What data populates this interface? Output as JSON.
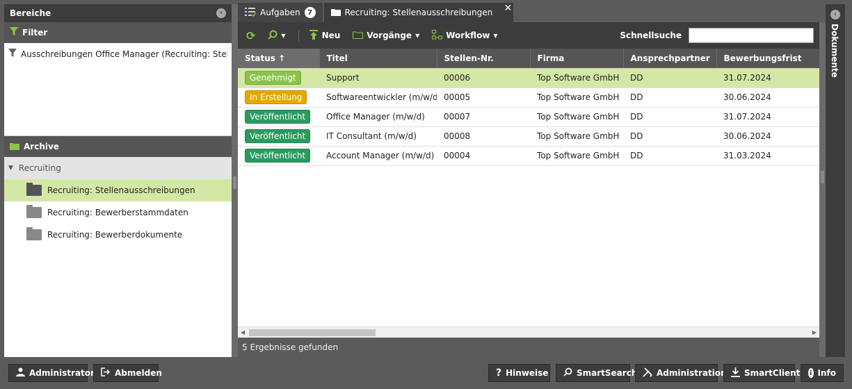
{
  "left": {
    "title": "Bereiche",
    "filter": {
      "label": "Filter",
      "items": [
        "Ausschreibungen Office Manager (Recruiting: Stellenausschreibungen)"
      ]
    },
    "archive": {
      "label": "Archive",
      "group": "Recruiting",
      "items": [
        {
          "label": "Recruiting: Stellenausschreibungen",
          "selected": true
        },
        {
          "label": "Recruiting: Bewerberstammdaten",
          "selected": false
        },
        {
          "label": "Recruiting: Bewerberdokumente",
          "selected": false
        }
      ]
    }
  },
  "tabs": [
    {
      "label": "Aufgaben",
      "badge": "7"
    },
    {
      "label": "Recruiting: Stellenausschreibungen",
      "active": true
    }
  ],
  "toolbar": {
    "new_label": "Neu",
    "procedures_label": "Vorgänge",
    "workflow_label": "Workflow",
    "quicksearch_label": "Schnellsuche",
    "quicksearch_value": ""
  },
  "table": {
    "columns": [
      "Status",
      "Titel",
      "Stellen-Nr.",
      "Firma",
      "Ansprechpartner",
      "Bewerbungsfrist"
    ],
    "sort_indicator": "↑",
    "rows": [
      {
        "status": "Genehmigt",
        "status_color": "#8bc34a",
        "titel": "Support",
        "nr": "00006",
        "firma": "Top Software GmbH",
        "ansprech": "DD",
        "frist": "31.07.2024",
        "selected": true
      },
      {
        "status": "In Erstellung",
        "status_color": "#e6a800",
        "titel": "Softwareentwickler (m/w/d)",
        "nr": "00005",
        "firma": "Top Software GmbH",
        "ansprech": "DD",
        "frist": "30.06.2024",
        "selected": false
      },
      {
        "status": "Veröffentlicht",
        "status_color": "#2a9a5e",
        "titel": "Office Manager (m/w/d)",
        "nr": "00007",
        "firma": "Top Software GmbH",
        "ansprech": "DD",
        "frist": "31.07.2024",
        "selected": false
      },
      {
        "status": "Veröffentlicht",
        "status_color": "#2a9a5e",
        "titel": "IT Consultant (m/w/d)",
        "nr": "00008",
        "firma": "Top Software GmbH",
        "ansprech": "DD",
        "frist": "30.06.2024",
        "selected": false
      },
      {
        "status": "Veröffentlicht",
        "status_color": "#2a9a5e",
        "titel": "Account Manager (m/w/d)",
        "nr": "00004",
        "firma": "Top Software GmbH",
        "ansprech": "DD",
        "frist": "31.03.2024",
        "selected": false
      }
    ]
  },
  "result_text": "5 Ergebnisse gefunden",
  "rightbar_label": "Dokumente",
  "bottom": {
    "user": "Administrator",
    "logout": "Abmelden",
    "hints": "Hinweise",
    "smartsearch": "SmartSearch",
    "admin": "Administration",
    "smartclient": "SmartClient",
    "info": "Info"
  },
  "colors": {
    "accent_green": "#8bc34a",
    "selected_row": "#d4e8a6"
  }
}
